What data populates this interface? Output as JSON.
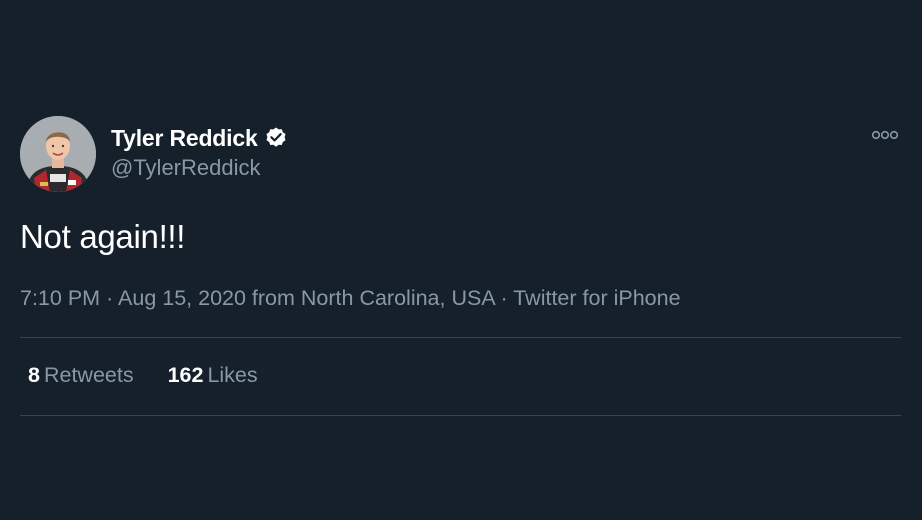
{
  "tweet": {
    "author": {
      "display_name": "Tyler Reddick",
      "handle": "@TylerReddick",
      "verified_icon": "verified-badge-icon",
      "avatar": "avatar-photo"
    },
    "more_icon": "more-options-icon",
    "text": "Not again!!!",
    "meta": {
      "time": "7:10 PM",
      "separator": "·",
      "date_location": "Aug 15, 2020 from North Carolina, USA",
      "source": "Twitter for iPhone"
    },
    "stats": {
      "retweets_count": "8",
      "retweets_label": "Retweets",
      "likes_count": "162",
      "likes_label": "Likes"
    }
  },
  "colors": {
    "background": "#15202b",
    "primary_text": "#ffffff",
    "secondary_text": "#8899a6",
    "divider": "#38444d"
  }
}
